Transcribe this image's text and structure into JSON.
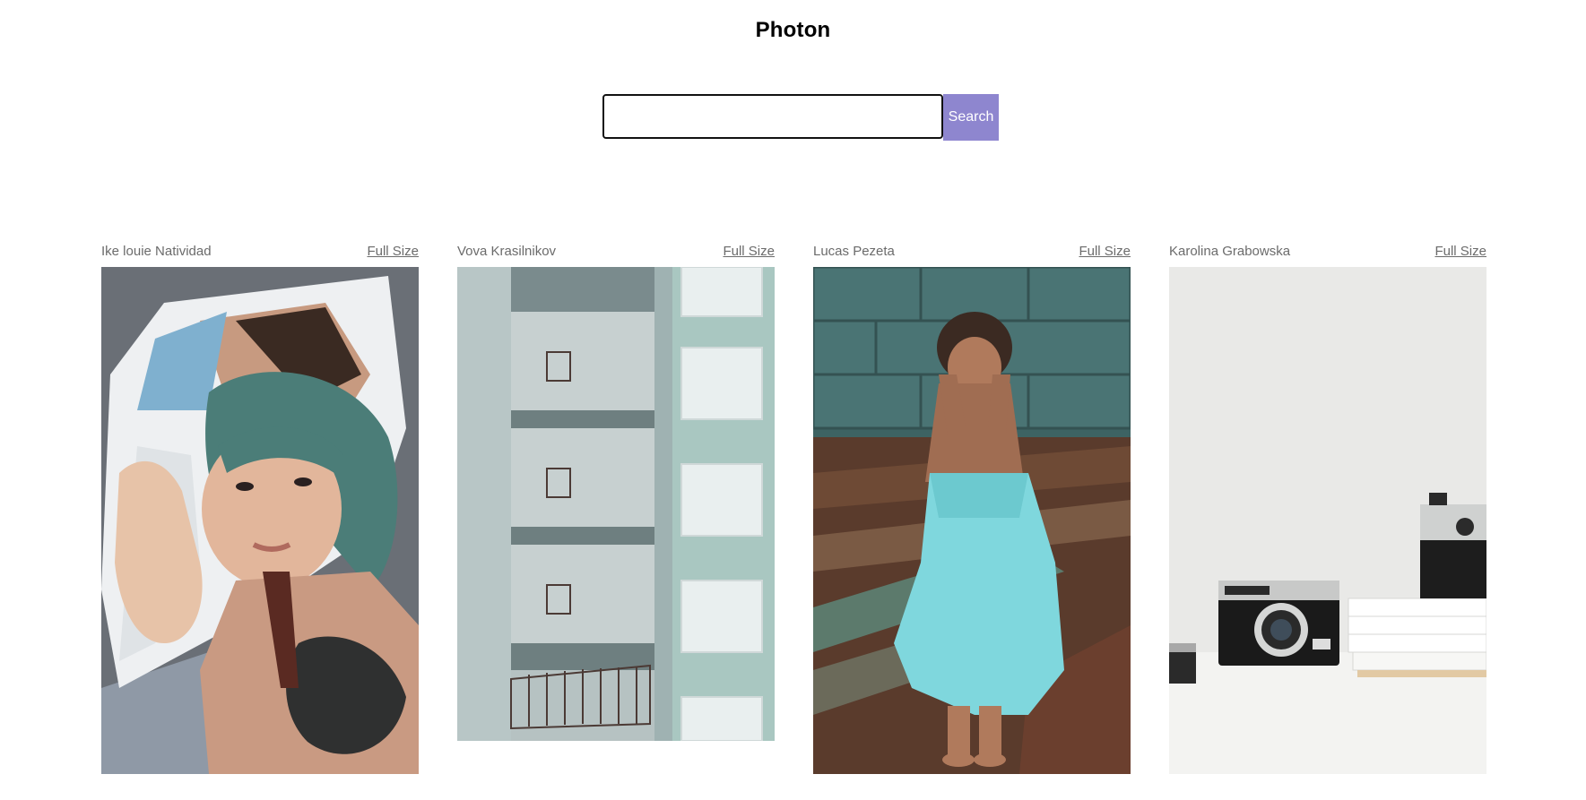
{
  "app": {
    "title": "Photon"
  },
  "search": {
    "value": "",
    "placeholder": "",
    "button_label": "Search",
    "button_color": "#8e86cf"
  },
  "photos": [
    {
      "author": "Ike louie Natividad",
      "link_label": "Full Size",
      "image": "portrait-woman-with-magazine"
    },
    {
      "author": "Vova Krasilnikov",
      "link_label": "Full Size",
      "image": "apartment-building-balconies"
    },
    {
      "author": "Lucas Pezeta",
      "link_label": "Full Size",
      "image": "woman-in-blue-dress-sitting"
    },
    {
      "author": "Karolina Grabowska",
      "link_label": "Full Size",
      "image": "vintage-cameras-on-books"
    }
  ]
}
